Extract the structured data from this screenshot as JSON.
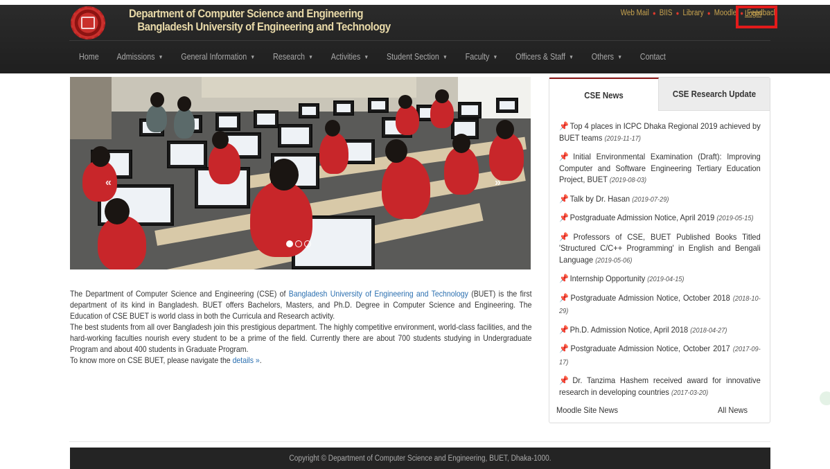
{
  "header": {
    "title_line1": "Department of Computer Science and Engineering",
    "title_line2": "Bangladesh University of Engineering and Technology",
    "util_links": [
      "Web Mail",
      "BIIS",
      "Library",
      "Moodle",
      "Feedback"
    ],
    "login": "Login"
  },
  "nav": {
    "items": [
      {
        "label": "Home",
        "dropdown": false
      },
      {
        "label": "Admissions",
        "dropdown": true
      },
      {
        "label": "General Information",
        "dropdown": true
      },
      {
        "label": "Research",
        "dropdown": true
      },
      {
        "label": "Activities",
        "dropdown": true
      },
      {
        "label": "Student Section",
        "dropdown": true
      },
      {
        "label": "Faculty",
        "dropdown": true
      },
      {
        "label": "Officers & Staff",
        "dropdown": true
      },
      {
        "label": "Others",
        "dropdown": true
      },
      {
        "label": "Contact",
        "dropdown": false
      }
    ]
  },
  "carousel": {
    "prev": "«",
    "next": "»",
    "slide_count": 3,
    "active_index": 0
  },
  "intro": {
    "p1_a": "The Department of Computer Science and Engineering (CSE) of ",
    "p1_link": "Bangladesh University of Engineering and Technology",
    "p1_b": " (BUET) is the first department of its kind in Bangladesh. BUET offers Bachelors, Masters, and Ph.D. Degree in Computer Science and Engineering. The Education of CSE BUET is world class in both the Curricula and Research activity.",
    "p2": "The best students from all over Bangladesh join this prestigious department. The highly competitive environment, world-class facilities, and the hard-working faculties nourish every student to be a prime of the field. Currently there are about 700 students studying in Undergraduate Program and about 400 students in Graduate Program.",
    "p3_a": "To know more on CSE BUET, please navigate the ",
    "p3_link": "details »",
    "p3_b": "."
  },
  "news": {
    "tab_active": "CSE News",
    "tab_other": "CSE Research Update",
    "items": [
      {
        "text": "Top 4 places in ICPC Dhaka Regional 2019 achieved by BUET teams",
        "date": "(2019-11-17)"
      },
      {
        "text": "Initial Environmental Examination (Draft): Improving Computer and Software Engineering Tertiary Education Project, BUET",
        "date": "(2019-08-03)"
      },
      {
        "text": "Talk by Dr. Hasan",
        "date": "(2019-07-29)"
      },
      {
        "text": "Postgraduate Admission Notice, April 2019",
        "date": "(2019-05-15)"
      },
      {
        "text": "Professors of CSE, BUET Published Books Titled 'Structured C/C++ Programming' in English and Bengali Language",
        "date": "(2019-05-06)"
      },
      {
        "text": "Internship Opportunity",
        "date": "(2019-04-15)"
      },
      {
        "text": "Postgraduate Admission Notice, October 2018",
        "date": "(2018-10-29)"
      },
      {
        "text": "Ph.D. Admission Notice, April 2018",
        "date": "(2018-04-27)"
      },
      {
        "text": "Postgraduate Admission Notice, October 2017",
        "date": "(2017-09-17)"
      },
      {
        "text": "Dr. Tanzima Hashem received award for innovative research in developing countries",
        "date": "(2017-03-20)"
      }
    ],
    "footer_left": "Moodle Site News",
    "footer_right": "All News"
  },
  "footer": {
    "copyright": "Copyright © Department of Computer Science and Engineering, BUET, Dhaka-1000."
  },
  "colors": {
    "header_bg": "#242424",
    "title_gold": "#e8d9a8",
    "link_blue": "#2a6fb0",
    "login_highlight": "#e31b1b",
    "tab_accent": "#8e1a1a"
  },
  "icons": {
    "news_pin": "pushpin-icon",
    "dropdown": "caret-down-icon",
    "logo": "buet-logo"
  }
}
